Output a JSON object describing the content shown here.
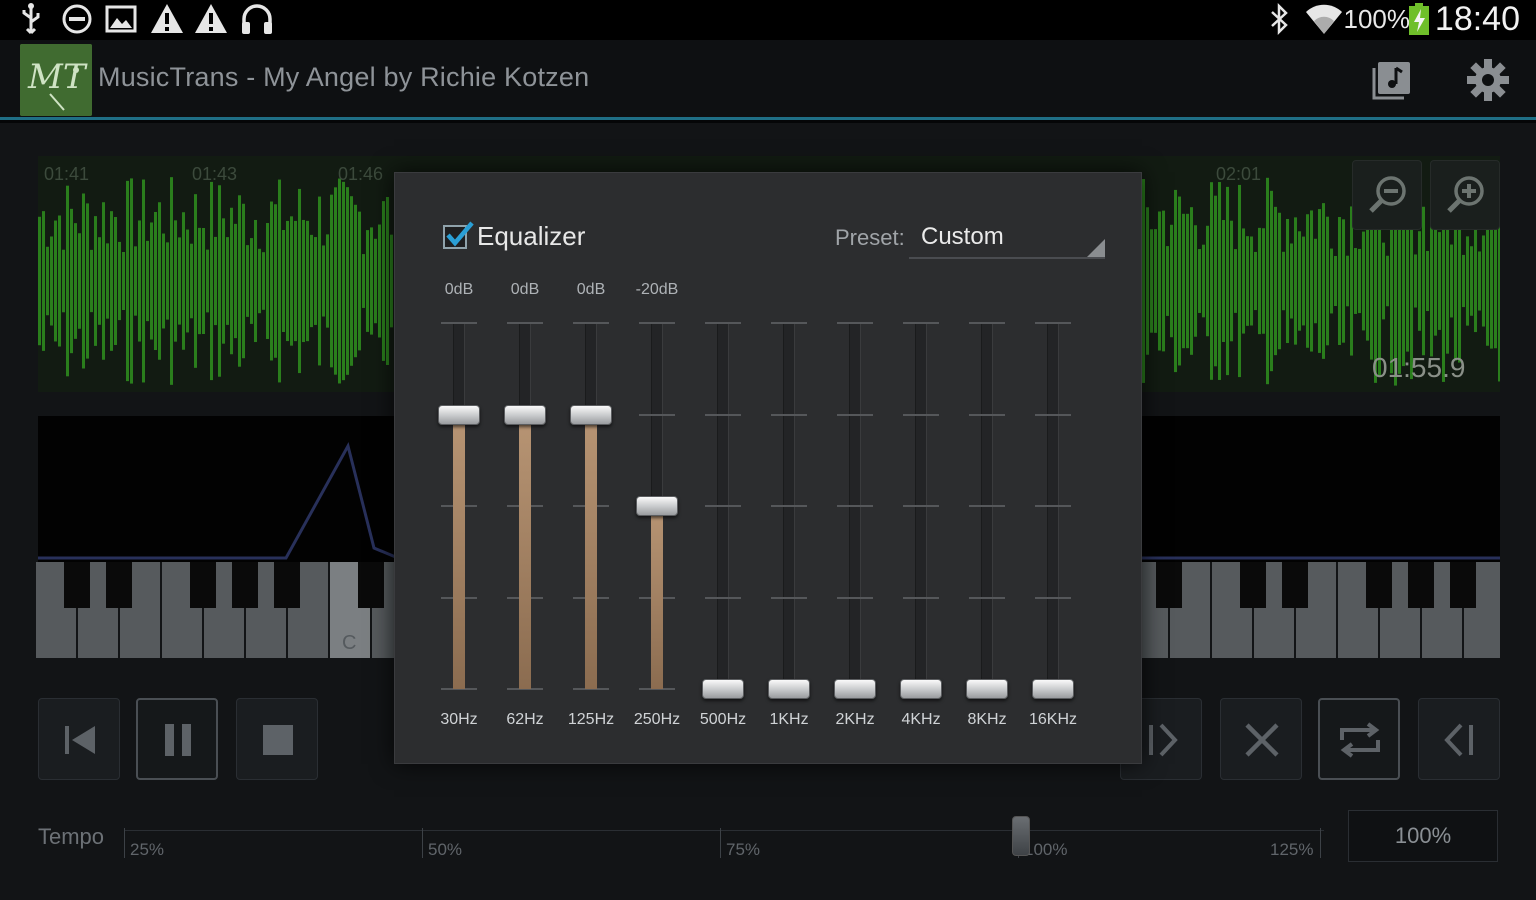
{
  "status_bar": {
    "icons": [
      "usb-icon",
      "do-not-disturb-icon",
      "image-icon",
      "warning-icon",
      "warning-icon",
      "headphones-icon",
      "bluetooth-icon",
      "wifi-icon",
      "battery-charging-icon"
    ],
    "battery": "100%",
    "time": "18:40"
  },
  "action_bar": {
    "app_logo_text": "MT",
    "title": "MusicTrans - My Angel by Richie Kotzen",
    "actions": [
      "music-library-icon",
      "settings-gear-icon"
    ]
  },
  "waveform": {
    "time_labels": [
      "01:41",
      "01:43",
      "01:46",
      "02:01"
    ],
    "current_time": "01:55.9",
    "color": "#2f8f1e"
  },
  "keyboard": {
    "label": "C"
  },
  "transport": {
    "buttons": [
      "skip-previous-icon",
      "pause-icon",
      "stop-icon",
      "mark-in-icon",
      "close-icon",
      "loop-icon",
      "mark-out-icon"
    ]
  },
  "tempo": {
    "label": "Tempo",
    "ticks": [
      "25%",
      "50%",
      "75%",
      "100%",
      "125%"
    ],
    "value": "100%",
    "thumb_fraction": 0.75
  },
  "equalizer": {
    "enabled": true,
    "label": "Equalizer",
    "preset_label": "Preset:",
    "preset_value": "Custom",
    "accent": "#2a9fd6",
    "bands": [
      {
        "freq": "30Hz",
        "db_label": "0dB",
        "level": 0.0
      },
      {
        "freq": "62Hz",
        "db_label": "0dB",
        "level": 0.0
      },
      {
        "freq": "125Hz",
        "db_label": "0dB",
        "level": 0.0
      },
      {
        "freq": "250Hz",
        "db_label": "-20dB",
        "level": -20
      },
      {
        "freq": "500Hz",
        "db_label": "",
        "level": -60
      },
      {
        "freq": "1KHz",
        "db_label": "",
        "level": -60
      },
      {
        "freq": "2KHz",
        "db_label": "",
        "level": -60
      },
      {
        "freq": "4KHz",
        "db_label": "",
        "level": -60
      },
      {
        "freq": "8KHz",
        "db_label": "",
        "level": -60
      },
      {
        "freq": "16KHz",
        "db_label": "",
        "level": -60
      }
    ]
  }
}
